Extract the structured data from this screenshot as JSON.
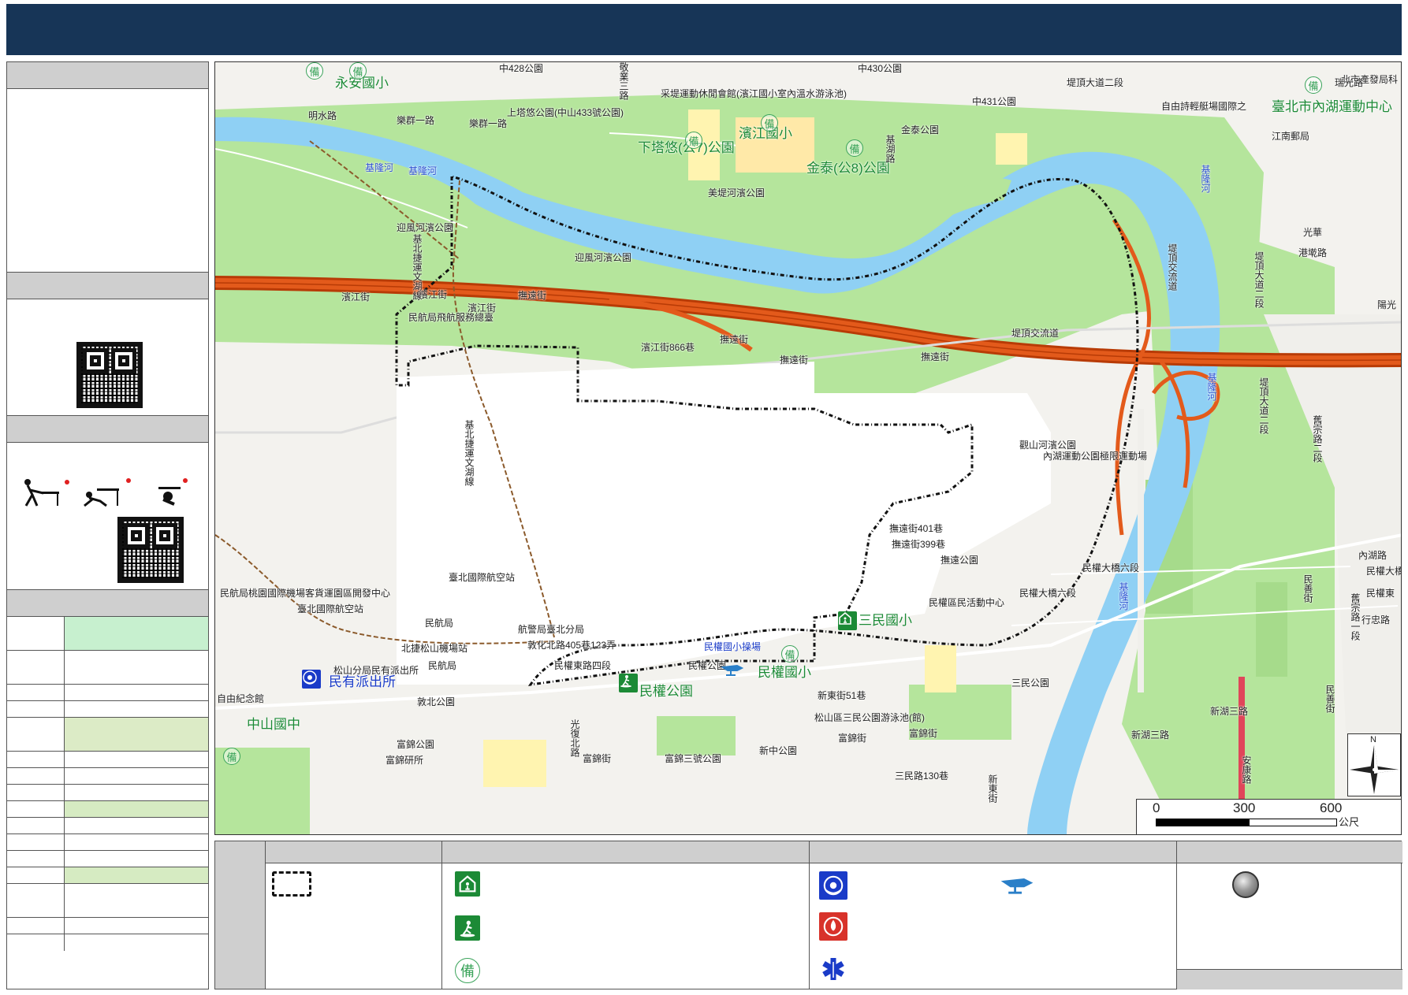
{
  "map": {
    "scale": {
      "ticks": [
        "0",
        "300",
        "600"
      ],
      "unit": "公尺"
    },
    "compass": {
      "north": "N"
    },
    "colors": {
      "river": "#8fd0f4",
      "park": "#b5e59c",
      "highway": "#e35a1b",
      "highway_core": "#b83b06",
      "boundary": "#111111",
      "header": "#173557"
    },
    "labels": [
      {
        "text": "永安國小",
        "cls": "big green"
      },
      {
        "text": "中428公園",
        "cls": ""
      },
      {
        "text": "中430公園",
        "cls": ""
      },
      {
        "text": "堤頂大道二段",
        "cls": ""
      },
      {
        "text": "北市產發局科",
        "cls": ""
      },
      {
        "text": "臺北市內湖運動中心",
        "cls": "big green"
      },
      {
        "text": "采堤運動休閒會館(濱江國小室內溫水游泳池)",
        "cls": ""
      },
      {
        "text": "中431公園",
        "cls": ""
      },
      {
        "text": "自由詩輕艇場國際之",
        "cls": ""
      },
      {
        "text": "明水路",
        "cls": ""
      },
      {
        "text": "上塔悠公園(中山433號公園)",
        "cls": ""
      },
      {
        "text": "樂群一路",
        "cls": ""
      },
      {
        "text": "樂群一路",
        "cls": ""
      },
      {
        "text": "下塔悠(公7)公園",
        "cls": "big green"
      },
      {
        "text": "濱江國小",
        "cls": "big green"
      },
      {
        "text": "金泰公園",
        "cls": ""
      },
      {
        "text": "金泰(公8)公園",
        "cls": "big green"
      },
      {
        "text": "江南郵局",
        "cls": ""
      },
      {
        "text": "基隆河",
        "cls": "river"
      },
      {
        "text": "基隆河",
        "cls": "river"
      },
      {
        "text": "美堤河濱公園",
        "cls": ""
      },
      {
        "text": "迎風河濱公園",
        "cls": ""
      },
      {
        "text": "迎風河濱公園",
        "cls": ""
      },
      {
        "text": "濱江街",
        "cls": ""
      },
      {
        "text": "濱江街",
        "cls": ""
      },
      {
        "text": "民航局飛航服務總臺",
        "cls": ""
      },
      {
        "text": "濱江街",
        "cls": ""
      },
      {
        "text": "撫遠街",
        "cls": ""
      },
      {
        "text": "濱江街866巷",
        "cls": ""
      },
      {
        "text": "撫遠街",
        "cls": ""
      },
      {
        "text": "撫遠街",
        "cls": ""
      },
      {
        "text": "撫遠街",
        "cls": ""
      },
      {
        "text": "堤頂交流道",
        "cls": ""
      },
      {
        "text": "觀山河濱公園",
        "cls": ""
      },
      {
        "text": "內湖運動公園極限運動場",
        "cls": ""
      },
      {
        "text": "撫遠街401巷",
        "cls": ""
      },
      {
        "text": "撫遠街399巷",
        "cls": ""
      },
      {
        "text": "撫遠公園",
        "cls": ""
      },
      {
        "text": "民權區民活動中心",
        "cls": ""
      },
      {
        "text": "民權大橋六段",
        "cls": ""
      },
      {
        "text": "民權大橋六段",
        "cls": ""
      },
      {
        "text": "三民國小",
        "cls": "big green"
      },
      {
        "text": "臺北國際航空站",
        "cls": ""
      },
      {
        "text": "民航局桃園國際機場客貨運園區開發中心",
        "cls": ""
      },
      {
        "text": "臺北國際航空站",
        "cls": ""
      },
      {
        "text": "民航局",
        "cls": ""
      },
      {
        "text": "航警局臺北分局",
        "cls": ""
      },
      {
        "text": "北捷松山機場站",
        "cls": ""
      },
      {
        "text": "敦化北路405巷123弄",
        "cls": ""
      },
      {
        "text": "民航局",
        "cls": ""
      },
      {
        "text": "松山分局民有派出所",
        "cls": ""
      },
      {
        "text": "民有派出所",
        "cls": "big blue"
      },
      {
        "text": "民權東路四段",
        "cls": ""
      },
      {
        "text": "民權國小操場",
        "cls": "blue"
      },
      {
        "text": "民權公園",
        "cls": ""
      },
      {
        "text": "民權國小",
        "cls": "big green"
      },
      {
        "text": "民權公園",
        "cls": "big green"
      },
      {
        "text": "新東街51巷",
        "cls": ""
      },
      {
        "text": "松山區三民公園游泳池(館)",
        "cls": ""
      },
      {
        "text": "三民公園",
        "cls": ""
      },
      {
        "text": "自由紀念館",
        "cls": ""
      },
      {
        "text": "中山國中",
        "cls": "big green"
      },
      {
        "text": "敦北公園",
        "cls": ""
      },
      {
        "text": "富錦公園",
        "cls": ""
      },
      {
        "text": "富錦研所",
        "cls": ""
      },
      {
        "text": "富錦街",
        "cls": ""
      },
      {
        "text": "富錦三號公園",
        "cls": ""
      },
      {
        "text": "新中公園",
        "cls": ""
      },
      {
        "text": "富錦街",
        "cls": ""
      },
      {
        "text": "富錦街",
        "cls": ""
      },
      {
        "text": "三民路130巷",
        "cls": ""
      },
      {
        "text": "新湖三路",
        "cls": ""
      },
      {
        "text": "新湖三路",
        "cls": ""
      },
      {
        "text": "民權大橋",
        "cls": ""
      },
      {
        "text": "民權東",
        "cls": ""
      },
      {
        "text": "行忠路",
        "cls": ""
      },
      {
        "text": "內湖路",
        "cls": ""
      },
      {
        "text": "陽光",
        "cls": ""
      },
      {
        "text": "港墘路",
        "cls": ""
      },
      {
        "text": "瑞光路",
        "cls": ""
      },
      {
        "text": "光華",
        "cls": ""
      }
    ],
    "vlabels": [
      {
        "text": "敬業三路",
        "cls": ""
      },
      {
        "text": "基湖路",
        "cls": ""
      },
      {
        "text": "堤頂交流道",
        "cls": ""
      },
      {
        "text": "堤頂大道二段",
        "cls": ""
      },
      {
        "text": "基北捷運文湖線",
        "cls": ""
      },
      {
        "text": "基北捷運文湖線",
        "cls": ""
      },
      {
        "text": "基隆河",
        "cls": "river"
      },
      {
        "text": "基隆河",
        "cls": "river"
      },
      {
        "text": "基隆河",
        "cls": "river"
      },
      {
        "text": "堤頂大道二段",
        "cls": ""
      },
      {
        "text": "舊宗路二段",
        "cls": ""
      },
      {
        "text": "光復北路",
        "cls": ""
      },
      {
        "text": "民善街",
        "cls": ""
      },
      {
        "text": "舊宗路一段",
        "cls": ""
      },
      {
        "text": "民善街",
        "cls": ""
      },
      {
        "text": "安康路",
        "cls": ""
      },
      {
        "text": "新東街",
        "cls": ""
      }
    ],
    "bei_symbol": "備",
    "pins": [
      {
        "kind": "shelter",
        "label": "三民國小"
      },
      {
        "kind": "park",
        "label": "民權公園"
      },
      {
        "kind": "police",
        "label": "民有派出所"
      },
      {
        "kind": "heli",
        "label": "民權國小操場"
      }
    ]
  },
  "legend": {
    "icons": [
      "boundary-icon",
      "shelter-icon",
      "evacuation-park-icon",
      "reserve-icon",
      "police-icon",
      "fire-icon",
      "medical-icon",
      "helipad-icon",
      "marker-icon"
    ]
  }
}
